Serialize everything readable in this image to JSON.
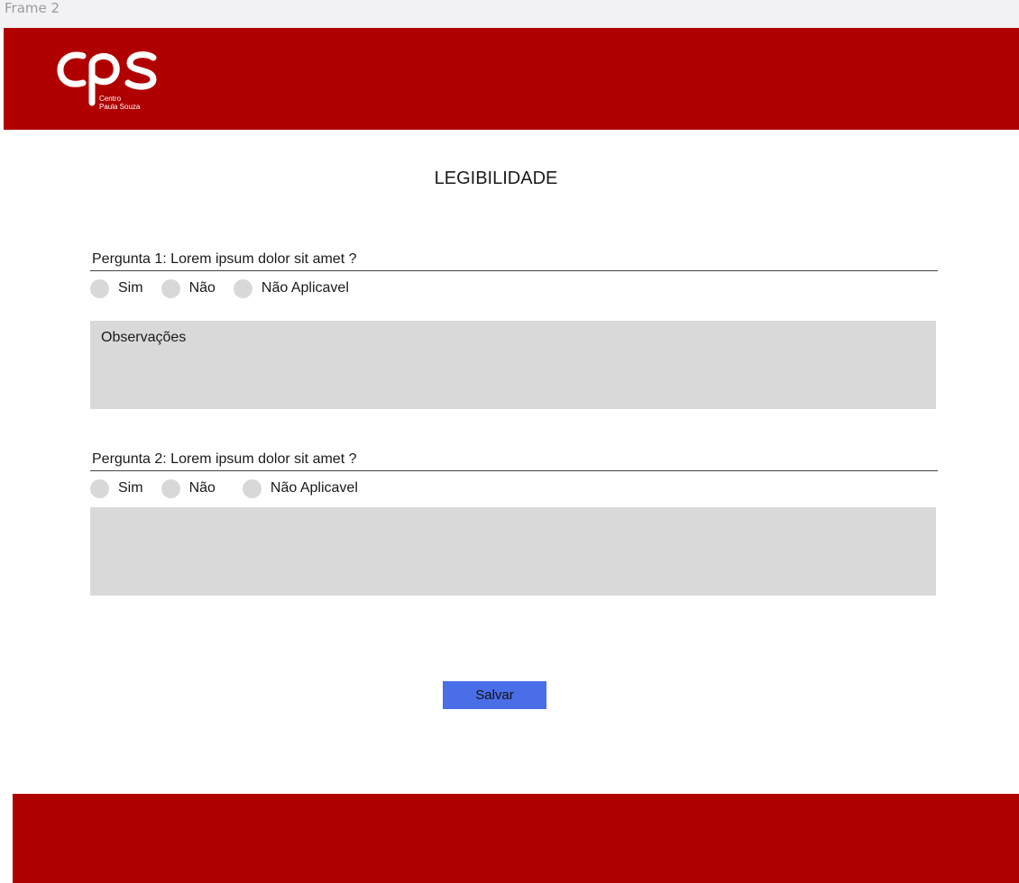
{
  "frame": {
    "label": "Frame 2"
  },
  "header": {
    "logo_wordmark": "cps",
    "logo_line1": "Centro",
    "logo_line2": "Paula Souza",
    "color": "#b00000"
  },
  "page": {
    "title": "LEGIBILIDADE"
  },
  "questions": [
    {
      "label": "Pergunta 1:  Lorem ipsum dolor sit amet ?",
      "options": [
        "Sim",
        "Não",
        "Não Aplicavel"
      ],
      "observation_placeholder": "Observações"
    },
    {
      "label": "Pergunta 2: Lorem ipsum dolor sit amet ?",
      "options": [
        "Sim",
        "Não",
        "Não Aplicavel"
      ],
      "observation_placeholder": ""
    }
  ],
  "actions": {
    "save_label": "Salvar",
    "save_color": "#4a6ee8"
  },
  "colors": {
    "brand_red": "#b00000",
    "field_gray": "#d9d9d9",
    "radio_gray": "#d8d8d8"
  }
}
